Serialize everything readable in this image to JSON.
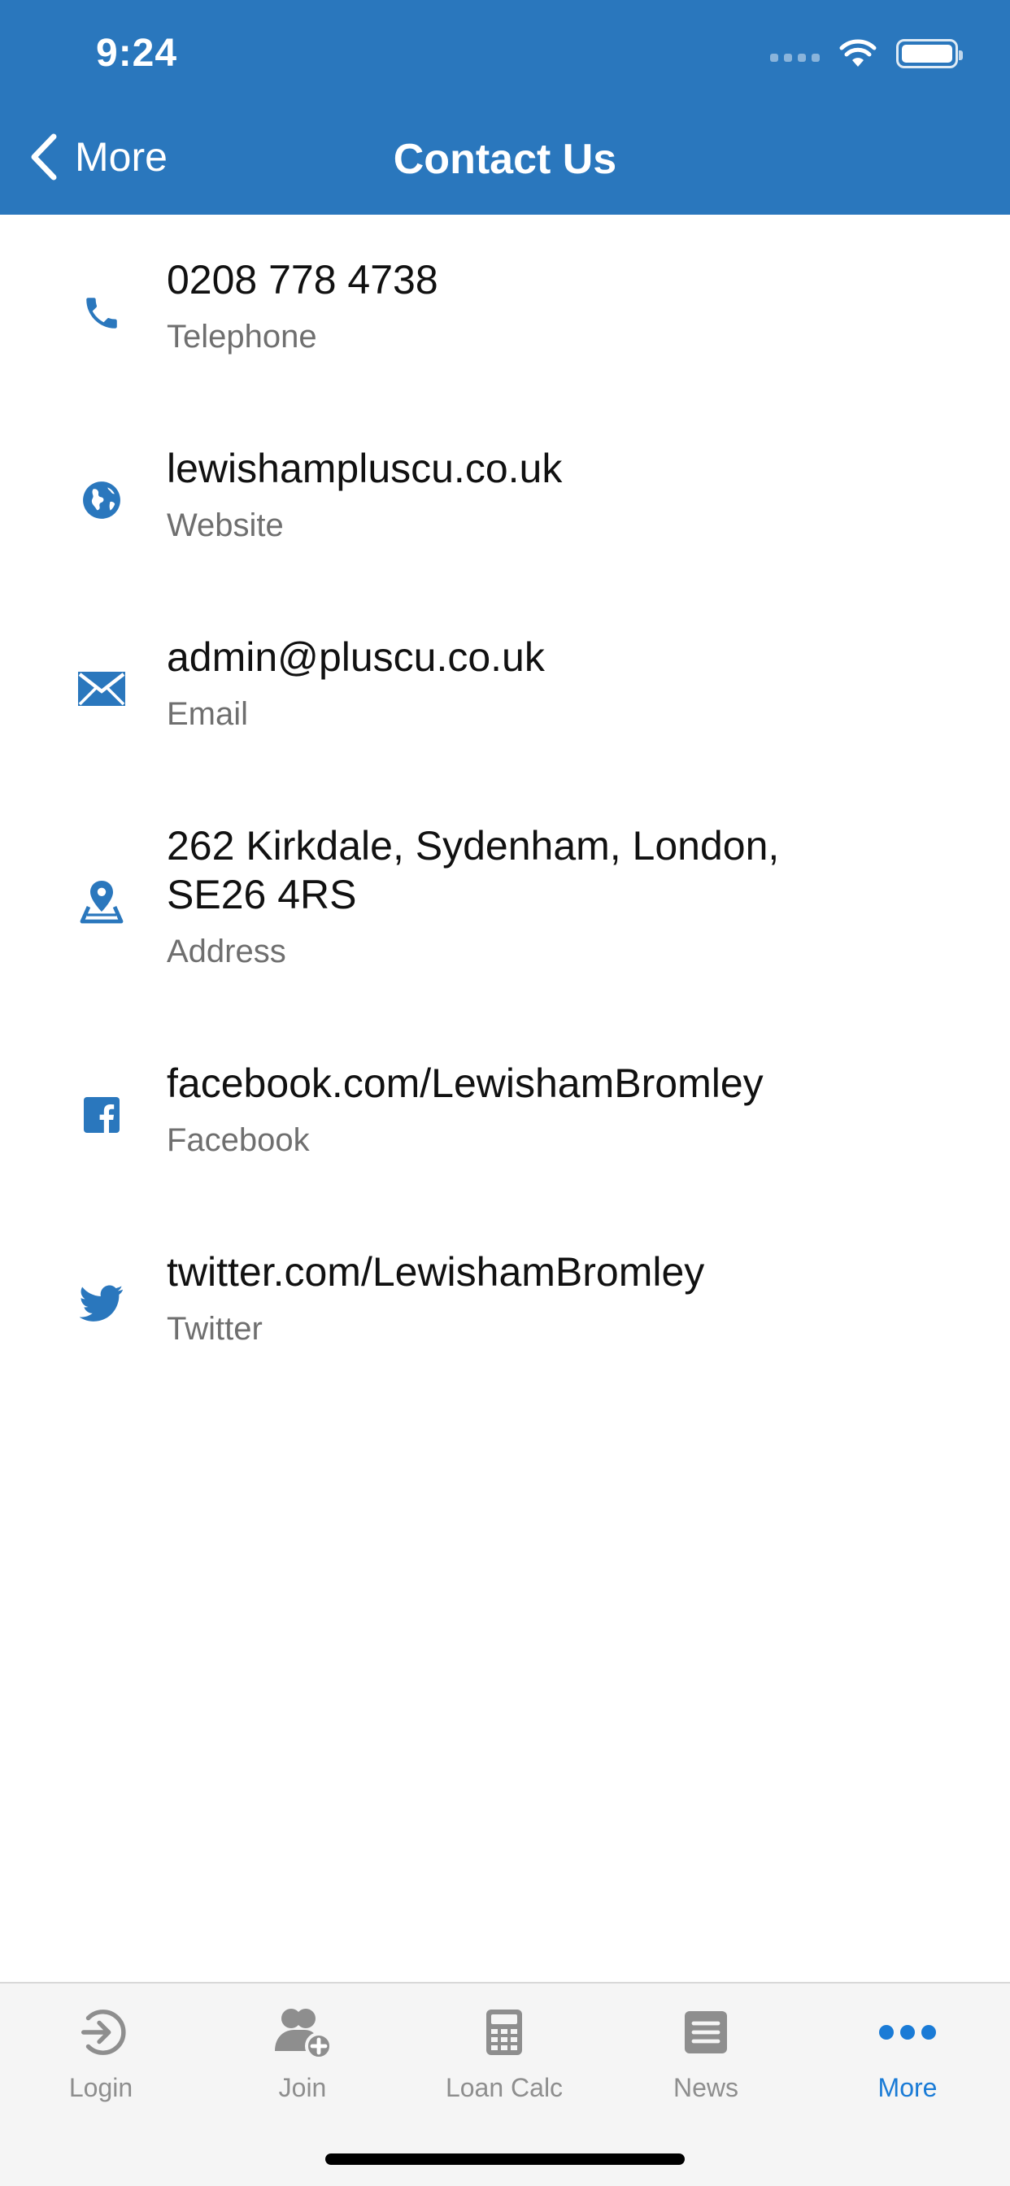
{
  "status_bar": {
    "time": "9:24"
  },
  "nav": {
    "back_label": "More",
    "title": "Contact Us"
  },
  "contacts": [
    {
      "icon": "phone-icon",
      "primary": "0208 778 4738",
      "secondary": "Telephone"
    },
    {
      "icon": "globe-icon",
      "primary": "lewishampluscu.co.uk",
      "secondary": "Website"
    },
    {
      "icon": "envelope-icon",
      "primary": "admin@pluscu.co.uk",
      "secondary": "Email"
    },
    {
      "icon": "map-pin-icon",
      "primary_line1": "262 Kirkdale, Sydenham, London,",
      "primary_line2": "SE26 4RS",
      "secondary": "Address"
    },
    {
      "icon": "facebook-icon",
      "primary": "facebook.com/LewishamBromley",
      "secondary": "Facebook"
    },
    {
      "icon": "twitter-icon",
      "primary": "twitter.com/LewishamBromley",
      "secondary": "Twitter"
    }
  ],
  "tabs": [
    {
      "label": "Login",
      "icon": "login-icon"
    },
    {
      "label": "Join",
      "icon": "add-user-icon"
    },
    {
      "label": "Loan Calc",
      "icon": "calculator-icon"
    },
    {
      "label": "News",
      "icon": "news-icon"
    },
    {
      "label": "More",
      "icon": "more-icon",
      "active": true
    }
  ],
  "colors": {
    "header": "#2a77bd",
    "icon_blue": "#2a77bd",
    "tab_active": "#1a7bd6",
    "tab_inactive": "#8e8e8e"
  }
}
